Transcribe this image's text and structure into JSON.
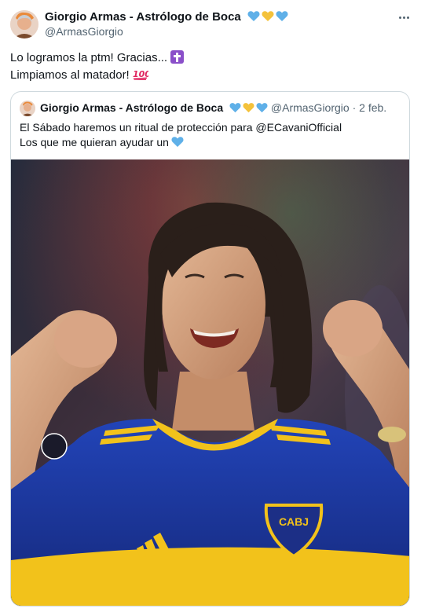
{
  "tweet": {
    "author_name": "Giorgio Armas - Astrólogo de Boca",
    "author_handle": "@ArmasGiorgio",
    "name_hearts": [
      "blue-heart",
      "yellow-heart",
      "blue-heart"
    ],
    "text_line1": "Lo logramos la ptm! Gracias...",
    "text_line1_emoji": "latin-cross-emoji",
    "text_line2": "Limpiamos al matador!",
    "text_line2_emoji": "hundred-points-emoji",
    "more_icon": "more-dots-icon"
  },
  "quote": {
    "author_name": "Giorgio Armas - Astrólogo de Boca",
    "name_hearts": [
      "blue-heart",
      "yellow-heart",
      "blue-heart"
    ],
    "author_handle": "@ArmasGiorgio",
    "separator": "·",
    "date": "2 feb.",
    "text_line1": "El Sábado haremos un ritual de protección para @ECavaniOfficial",
    "text_line2": "Los que me quieran ayudar un",
    "text_line2_emoji": "blue-heart",
    "media_badge_text": "CABJ"
  },
  "colors": {
    "text_primary": "#0f1419",
    "text_secondary": "#536471",
    "border": "#cfd9de",
    "heart_blue": "#5fb0e8",
    "heart_yellow": "#f4c23b",
    "boca_blue": "#1f3ea8",
    "boca_yellow": "#f2c21b"
  }
}
